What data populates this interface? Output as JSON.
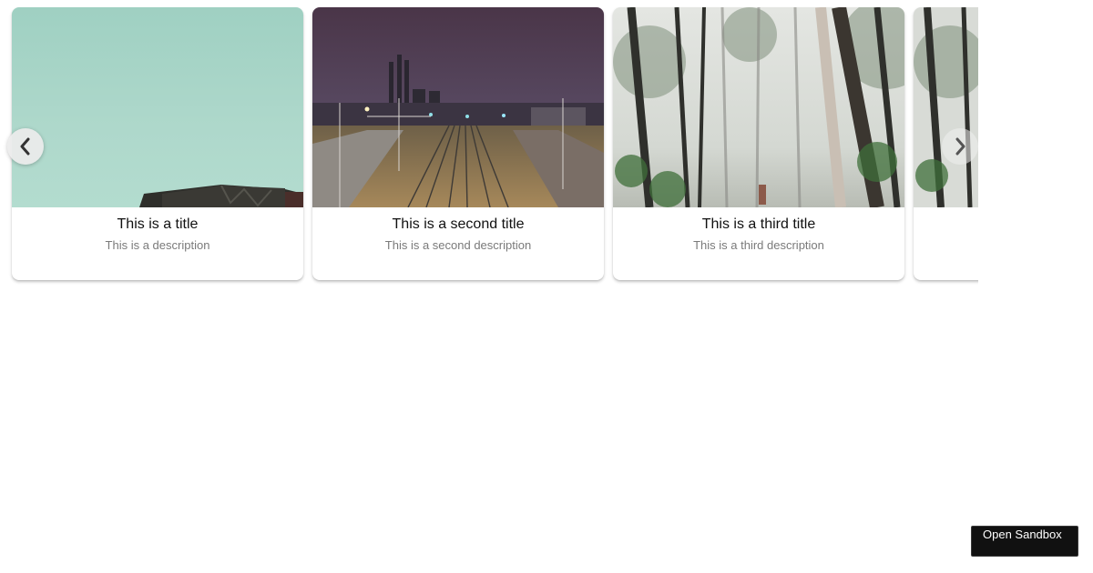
{
  "carousel": {
    "cards": [
      {
        "title": "This is a title",
        "description": "This is a description",
        "image": "sky-and-building-photo"
      },
      {
        "title": "This is a second title",
        "description": "This is a second description",
        "image": "railway-at-night-photo"
      },
      {
        "title": "This is a third title",
        "description": "This is a third description",
        "image": "misty-forest-photo"
      },
      {
        "title": "",
        "description": "",
        "image": "misty-forest-photo"
      }
    ],
    "prev_icon": "chevron-left-icon",
    "next_icon": "chevron-right-icon"
  },
  "sandbox": {
    "button_label": "Open Sandbox"
  },
  "colors": {
    "page_background": "#ffffff",
    "title_text": "#111111",
    "description_text": "#7a7a7a",
    "sandbox_button_bg": "#111111"
  }
}
